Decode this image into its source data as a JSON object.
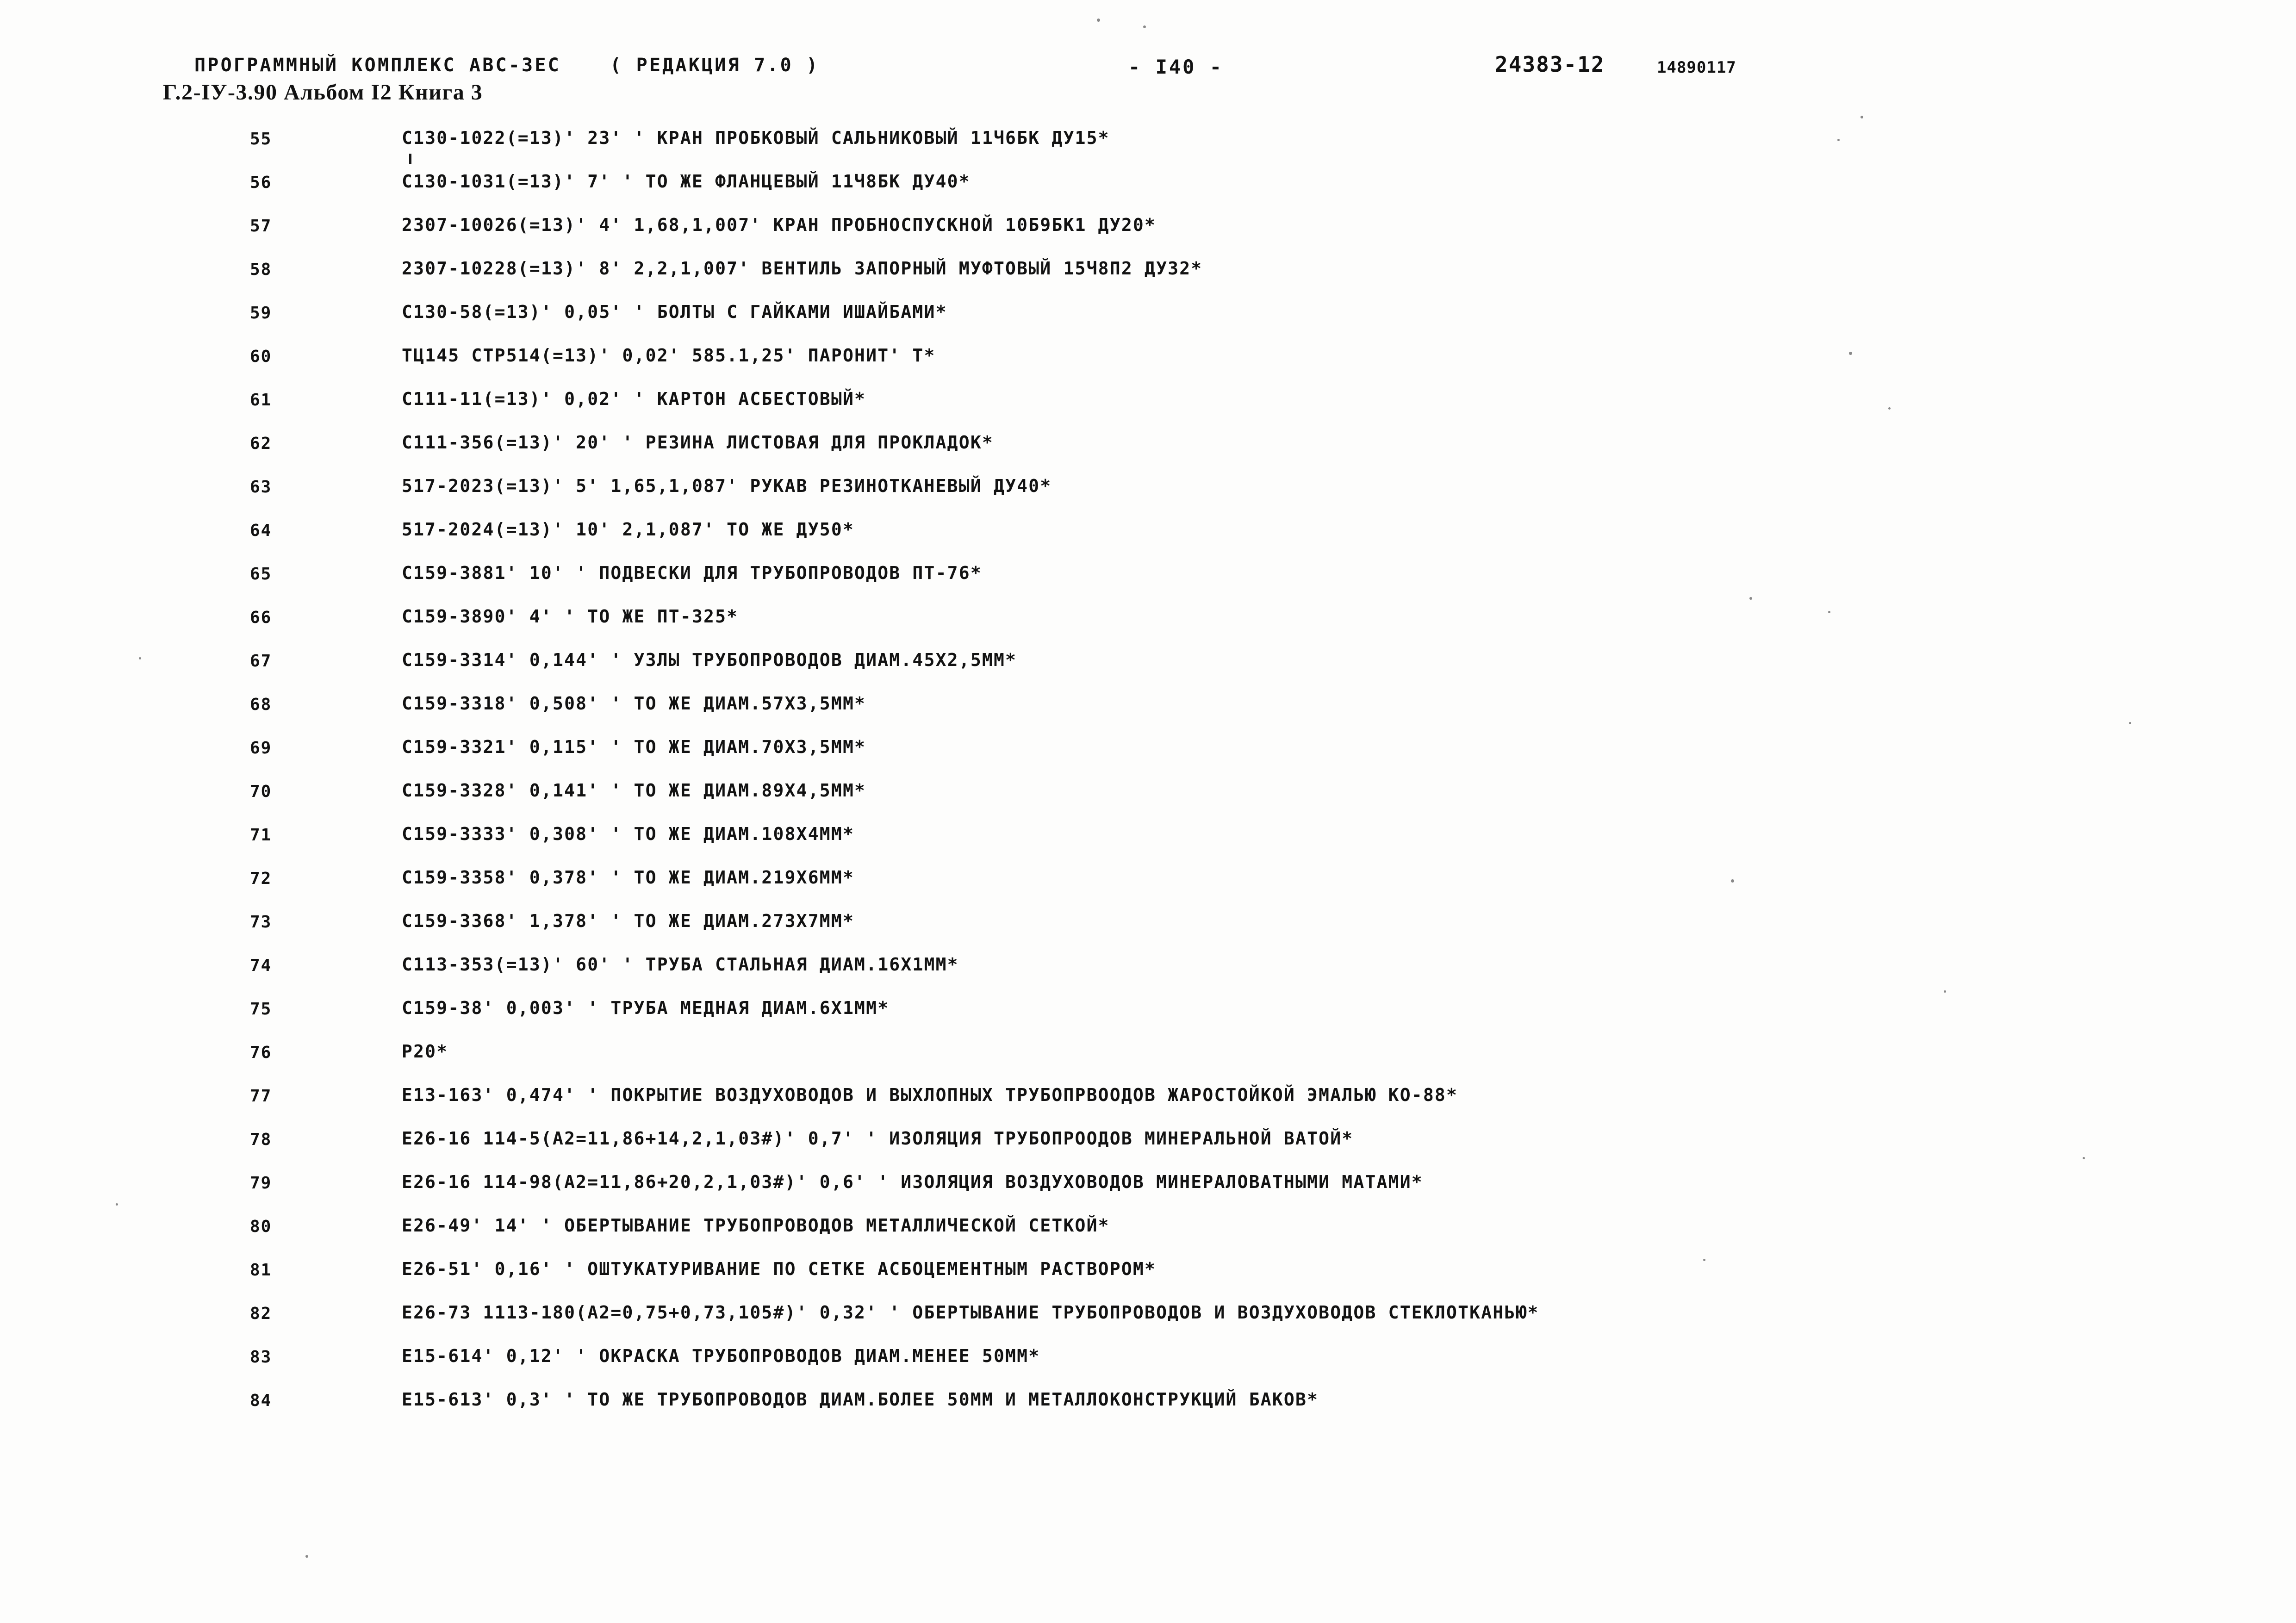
{
  "header": {
    "program_complex": "ПРОГРАММНЫЙ КОМПЛЕКС АВС-ЗЕС",
    "edition": "( РЕДАКЦИЯ  7.0 )",
    "page_number": "- I40 -",
    "document_code": "24383-12",
    "serial_number": "14890117",
    "album_line": "Г.2-IУ-3.90 Альбом I2 Книга 3"
  },
  "listing": {
    "rows": [
      {
        "num": "55",
        "text": "С130-1022(=13)' 23' ' КРАН ПРОБКОВЫЙ САЛЬНИКОВЫЙ 11Ч6БК ДУ15*"
      },
      {
        "num": "56",
        "text": "С130-1031(=13)' 7' ' ТО ЖЕ ФЛАНЦЕВЫЙ 11Ч8БК ДУ40*"
      },
      {
        "num": "57",
        "text": "2307-10026(=13)' 4' 1,68,1,007' КРАН ПРОБНОСПУСКНОЙ 10Б9БК1 ДУ20*"
      },
      {
        "num": "58",
        "text": "2307-10228(=13)' 8' 2,2,1,007' ВЕНТИЛЬ ЗАПОРНЫЙ МУФТОВЫЙ 15Ч8П2 ДУ32*"
      },
      {
        "num": "59",
        "text": "С130-58(=13)' 0,05' ' БОЛТЫ С ГАЙКАМИ ИШАЙБАМИ*"
      },
      {
        "num": "60",
        "text": "ТЦ145 СТР514(=13)' 0,02' 585.1,25' ПАРОНИТ' Т*"
      },
      {
        "num": "61",
        "text": "С111-11(=13)' 0,02' ' КАРТОН АСБЕСТОВЫЙ*"
      },
      {
        "num": "62",
        "text": "С111-356(=13)' 20' ' РЕЗИНА ЛИСТОВАЯ ДЛЯ ПРОКЛАДОК*"
      },
      {
        "num": "63",
        "text": "517-2023(=13)' 5' 1,65,1,087' РУКАВ РЕЗИНОТКАНЕВЫЙ ДУ40*"
      },
      {
        "num": "64",
        "text": "517-2024(=13)' 10' 2,1,087' ТО ЖЕ ДУ50*"
      },
      {
        "num": "65",
        "text": "С159-3881' 10' ' ПОДВЕСКИ ДЛЯ ТРУБОПРОВОДОВ ПТ-76*"
      },
      {
        "num": "66",
        "text": "С159-3890' 4' ' ТО ЖЕ ПТ-325*"
      },
      {
        "num": "67",
        "text": "С159-3314' 0,144' ' УЗЛЫ ТРУБОПРОВОДОВ ДИАМ.45Х2,5ММ*"
      },
      {
        "num": "68",
        "text": "С159-3318' 0,508' ' ТО ЖЕ ДИАМ.57Х3,5ММ*"
      },
      {
        "num": "69",
        "text": "С159-3321' 0,115' ' ТО ЖЕ ДИАМ.70Х3,5ММ*"
      },
      {
        "num": "70",
        "text": "С159-3328' 0,141' ' ТО ЖЕ ДИАМ.89Х4,5ММ*"
      },
      {
        "num": "71",
        "text": "С159-3333' 0,308' ' ТО ЖЕ ДИАМ.108Х4ММ*"
      },
      {
        "num": "72",
        "text": "С159-3358' 0,378' ' ТО ЖЕ ДИАМ.219Х6ММ*"
      },
      {
        "num": "73",
        "text": "С159-3368' 1,378' ' ТО ЖЕ ДИАМ.273Х7ММ*"
      },
      {
        "num": "74",
        "text": "С113-353(=13)' 60' ' ТРУБА СТАЛЬНАЯ ДИАМ.16Х1ММ*"
      },
      {
        "num": "75",
        "text": "С159-38' 0,003' ' ТРУБА МЕДНАЯ ДИАМ.6Х1ММ*"
      },
      {
        "num": "76",
        "text": "Р20*"
      },
      {
        "num": "77",
        "text": "Е13-163' 0,474' ' ПОКРЫТИЕ ВОЗДУХОВОДОВ И ВЫХЛОПНЫХ ТРУБОПРВООДОВ ЖАРОСТОЙКОЙ ЭМАЛЬЮ КО-88*"
      },
      {
        "num": "78",
        "text": "Е26-16 114-5(А2=11,86+14,2,1,03#)' 0,7' ' ИЗОЛЯЦИЯ ТРУБОПРООДОВ МИНЕРАЛЬНОЙ ВАТОЙ*"
      },
      {
        "num": "79",
        "text": "Е26-16 114-98(А2=11,86+20,2,1,03#)' 0,6' ' ИЗОЛЯЦИЯ ВОЗДУХОВОДОВ МИНЕРАЛОВАТНЫМИ МАТАМИ*"
      },
      {
        "num": "80",
        "text": "Е26-49' 14' ' ОБЕРТЫВАНИЕ ТРУБОПРОВОДОВ МЕТАЛЛИЧЕСКОЙ СЕТКОЙ*"
      },
      {
        "num": "81",
        "text": "Е26-51' 0,16' ' ОШТУКАТУРИВАНИЕ ПО СЕТКЕ АСБОЦЕМЕНТНЫМ РАСТВОРОМ*"
      },
      {
        "num": "82",
        "text": "Е26-73 1113-180(А2=0,75+0,73,105#)' 0,32' ' ОБЕРТЫВАНИЕ ТРУБОПРОВОДОВ И ВОЗДУХОВОДОВ СТЕКЛОТКАНЬЮ*"
      },
      {
        "num": "83",
        "text": "Е15-614' 0,12' ' ОКРАСКА ТРУБОПРОВОДОВ ДИАМ.МЕНЕЕ 50ММ*"
      },
      {
        "num": "84",
        "text": "Е15-613' 0,3' ' ТО ЖЕ ТРУБОПРОВОДОВ ДИАМ.БОЛЕЕ 50ММ И МЕТАЛЛОКОНСТРУКЦИЙ БАКОВ*"
      }
    ]
  }
}
